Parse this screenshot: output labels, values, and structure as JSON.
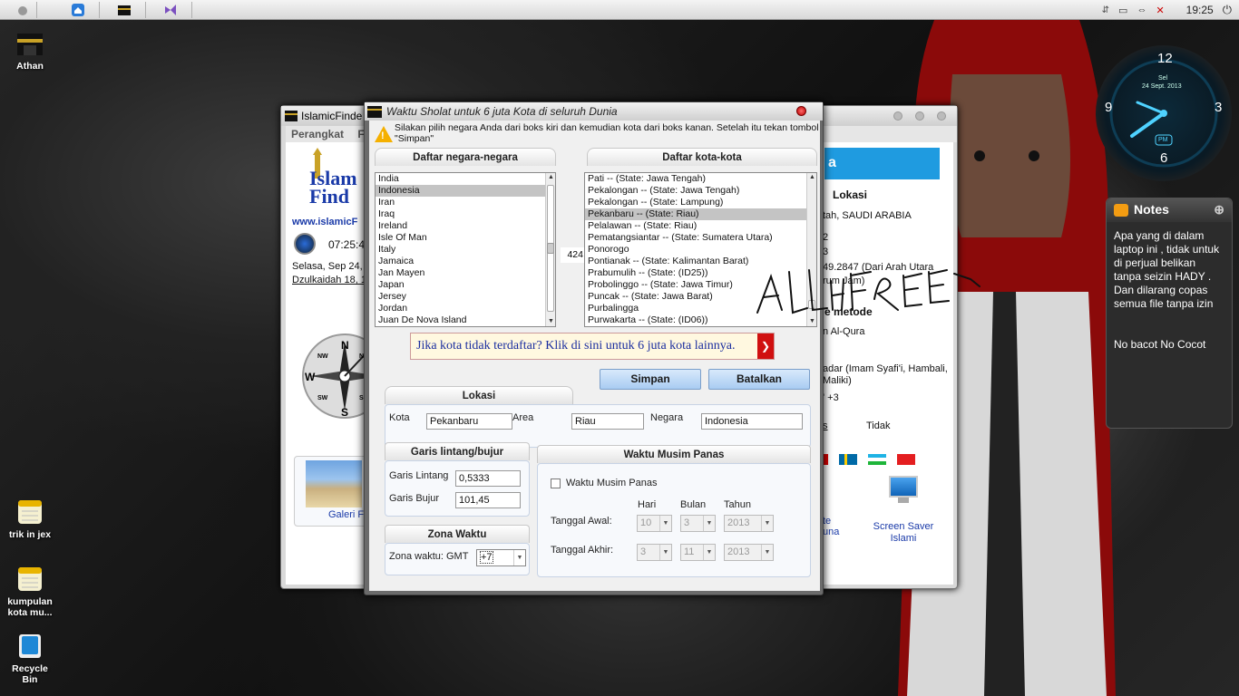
{
  "topbar": {
    "clock": "19:25"
  },
  "desktop_icons": [
    {
      "label": "Athan"
    },
    {
      "label": "trik in jex"
    },
    {
      "label": "kumpulan kota mu..."
    },
    {
      "label": "Recycle Bin"
    }
  ],
  "back_window": {
    "title": "IslamicFinde",
    "menu": [
      "Perangkat",
      "F"
    ],
    "logo_text": "Islam Find",
    "url": "www.islamicF",
    "time": "07:25:4",
    "date": "Selasa, Sep 24,",
    "hijri": "Dzulkaidah 18, 1",
    "compass_letters": [
      "N",
      "S",
      "W",
      "E",
      "NE",
      "SE",
      "SW",
      "NW"
    ],
    "gallery_label": "Galeri Fo",
    "right_panel": {
      "header": "a",
      "lokasi_title": "Lokasi",
      "lokasi_line1": "tah, SAUDI ARABIA",
      "lokasi_line2": "2",
      "lokasi_line3": "3",
      "lokasi_line4": "49.2847 (Dari Arah Utara",
      "lokasi_line5": "rum Jam)",
      "metode_title": "e metode",
      "metode_line1": "n Al-Qura",
      "metode_line2": "adar (Imam Syafi'i, Hambali,",
      "metode_line3": "Maliki)",
      "metode_line4": "' +3",
      "metode_line5": "s",
      "metode_line6": "Tidak",
      "bottom_item1": "te",
      "bottom_item1b": "una",
      "bottom_item2": "Screen Saver Islami"
    }
  },
  "dialog": {
    "title": "Waktu Sholat untuk 6 juta Kota di seluruh Dunia",
    "instruction": "Silakan pilih negara Anda dari boks kiri dan kemudian kota dari boks kanan. Setelah itu tekan tombol \"Simpan\"",
    "countries_title": "Daftar negara-negara",
    "countries": [
      "India",
      "Indonesia",
      "Iran",
      "Iraq",
      "Ireland",
      "Isle Of Man",
      "Italy",
      "Jamaica",
      "Jan Mayen",
      "Japan",
      "Jersey",
      "Jordan",
      "Juan De Nova Island"
    ],
    "selected_country": "Indonesia",
    "city_count": "424",
    "cities_title": "Daftar kota-kota",
    "cities": [
      "Pati -- (State: Jawa Tengah)",
      "Pekalongan -- (State: Jawa Tengah)",
      "Pekalongan -- (State: Lampung)",
      "Pekanbaru -- (State: Riau)",
      "Pelalawan -- (State: Riau)",
      "Pematangsiantar -- (State: Sumatera Utara)",
      "Ponorogo",
      "Pontianak -- (State: Kalimantan Barat)",
      "Prabumulih -- (State: (ID25))",
      "Probolinggo -- (State: Jawa Timur)",
      "Puncak -- (State: Jawa Barat)",
      "Purbalingga",
      "Purwakarta -- (State: (ID06))"
    ],
    "selected_city": "Pekanbaru -- (State: Riau)",
    "banner": "Jika kota tidak terdaftar? Klik di sini untuk 6 juta kota lainnya.",
    "save_label": "Simpan",
    "cancel_label": "Batalkan",
    "lokasi": {
      "title": "Lokasi",
      "kota_label": "Kota",
      "kota_value": "Pekanbaru",
      "area_label": "Area",
      "area_value": "Riau",
      "negara_label": "Negara",
      "negara_value": "Indonesia"
    },
    "coords": {
      "title": "Garis lintang/bujur",
      "lat_label": "Garis Lintang",
      "lat_value": "0,5333",
      "lon_label": "Garis Bujur",
      "lon_value": "101,45"
    },
    "timezone": {
      "title": "Zona Waktu",
      "label": "Zona waktu: GMT",
      "value": "+7"
    },
    "summer": {
      "title": "Waktu Musim Panas",
      "checkbox_label": "Waktu Musim Panas",
      "col_day": "Hari",
      "col_month": "Bulan",
      "col_year": "Tahun",
      "start_label": "Tanggal Awal:",
      "start_day": "10",
      "start_month": "3",
      "start_year": "2013",
      "end_label": "Tanggal Akhir:",
      "end_day": "3",
      "end_month": "11",
      "end_year": "2013"
    }
  },
  "clock_widget": {
    "day": "Sel",
    "date": "24 Sept. 2013",
    "numbers": [
      "12",
      "3",
      "6",
      "9"
    ],
    "ampm": "PM"
  },
  "notes_widget": {
    "title": "Notes",
    "body": "Apa yang di dalam laptop ini , tidak untuk di perjual belikan tanpa seizin HADY . Dan dilarang copas semua file tanpa izin\n\n\nNo bacot No Cocot"
  },
  "signature": "ALLHFREE",
  "colors": {
    "accent_blue": "#1f9be0",
    "banner_text": "#1b2e9f",
    "button_blue": "#a9ccf2"
  }
}
